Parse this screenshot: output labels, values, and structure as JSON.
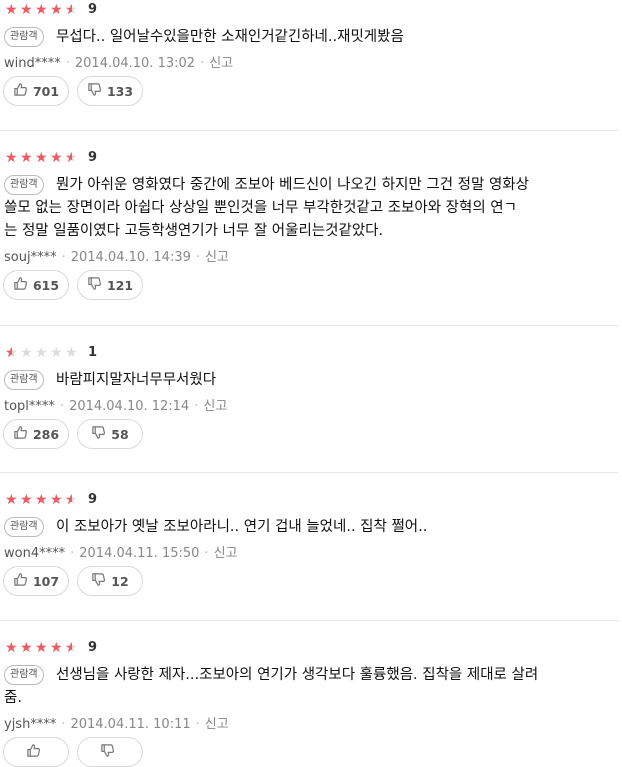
{
  "reviews": [
    {
      "rating": 4.5,
      "score": "9",
      "badge": "관람객",
      "lines": [
        "무섭다.. 일어날수있을만한 소재인거같긴하네..재밋게봤음"
      ],
      "user": "wind****",
      "date": "2014.04.10. 13:02",
      "report": "신고",
      "likes": "701",
      "dislikes": "133"
    },
    {
      "rating": 4.5,
      "score": "9",
      "badge": "관람객",
      "lines": [
        "뭔가 아쉬운 영화였다 중간에 조보아 베드신이 나오긴 하지만 그건 정말 영화상",
        "쓸모 없는 장면이라 아쉽다 상상일 뿐인것을 너무 부각한것같고 조보아와 장혁의 연ㄱ",
        "는 정말 일품이였다 고등학생연기가 너무 잘 어울리는것같았다."
      ],
      "user": "souj****",
      "date": "2014.04.10. 14:39",
      "report": "신고",
      "likes": "615",
      "dislikes": "121"
    },
    {
      "rating": 0.5,
      "score": "1",
      "badge": "관람객",
      "lines": [
        "바람피지말자너무무서웠다"
      ],
      "user": "topl****",
      "date": "2014.04.10. 12:14",
      "report": "신고",
      "likes": "286",
      "dislikes": "58"
    },
    {
      "rating": 4.5,
      "score": "9",
      "badge": "관람객",
      "lines": [
        "이 조보아가 옛날 조보아라니.. 연기 겁내 늘었네.. 집착 쩔어.."
      ],
      "user": "won4****",
      "date": "2014.04.11. 15:50",
      "report": "신고",
      "likes": "107",
      "dislikes": "12"
    },
    {
      "rating": 4.5,
      "score": "9",
      "badge": "관람객",
      "lines": [
        "선생님을 사랑한 제자...조보아의 연기가 생각보다 훌륭했음. 집착을 제대로 살려",
        "줌."
      ],
      "user": "yjsh****",
      "date": "2014.04.11. 10:11",
      "report": "신고",
      "likes": "",
      "dislikes": ""
    }
  ],
  "colors": {
    "star_filled": "#f05a63",
    "star_empty": "#dcdcdc",
    "meta": "#888888",
    "border": "#d9d9d9"
  },
  "icons": {
    "like": "thumbs-up-icon",
    "dislike": "thumbs-down-icon",
    "star": "star-icon"
  }
}
